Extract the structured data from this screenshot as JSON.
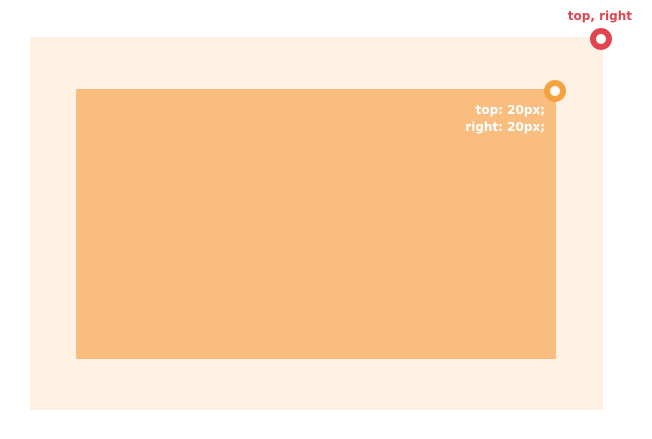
{
  "outer_label": "top, right",
  "inner_label": {
    "top_line": "top: 20px;",
    "right_line": "right: 20px;"
  },
  "colors": {
    "outer_fill": "#fff0e4",
    "inner_fill": "#f8bd7f",
    "outer_marker": "#e0464f",
    "inner_marker": "#f4a23f",
    "outer_label": "#e0464f",
    "inner_label": "#ffffff"
  }
}
